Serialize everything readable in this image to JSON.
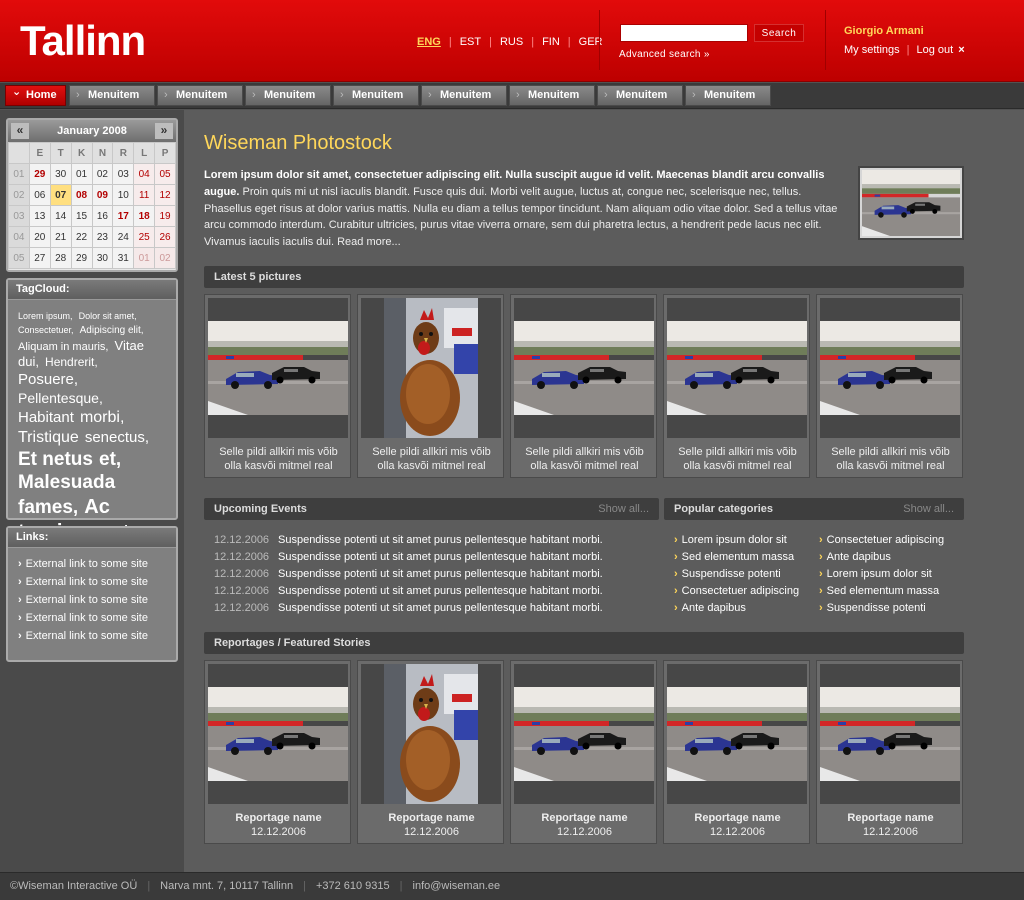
{
  "header": {
    "logo": "Tallinn",
    "languages": [
      {
        "label": "ENG",
        "active": true
      },
      {
        "label": "EST",
        "active": false
      },
      {
        "label": "RUS",
        "active": false
      },
      {
        "label": "FIN",
        "active": false
      },
      {
        "label": "GER",
        "active": false
      }
    ],
    "search": {
      "placeholder": "",
      "button": "Search",
      "advanced": "Advanced search »"
    },
    "user": {
      "name": "Giorgio Armani",
      "settings": "My settings",
      "logout": "Log out",
      "logout_icon": "×"
    }
  },
  "nav": {
    "items": [
      "Home",
      "Menuitem",
      "Menuitem",
      "Menuitem",
      "Menuitem",
      "Menuitem",
      "Menuitem",
      "Menuitem",
      "Menuitem"
    ]
  },
  "calendar": {
    "title": "January 2008",
    "prev": "«",
    "next": "»",
    "day_headers": [
      "",
      "E",
      "T",
      "K",
      "N",
      "R",
      "L",
      "P"
    ],
    "weeks": [
      [
        "01",
        "29",
        "30",
        "01",
        "02",
        "03",
        "04",
        "05"
      ],
      [
        "02",
        "06",
        "07",
        "08",
        "09",
        "10",
        "11",
        "12"
      ],
      [
        "03",
        "13",
        "14",
        "15",
        "16",
        "17",
        "18",
        "19"
      ],
      [
        "04",
        "20",
        "21",
        "22",
        "23",
        "24",
        "25",
        "26"
      ],
      [
        "05",
        "27",
        "28",
        "29",
        "30",
        "31",
        "01",
        "02"
      ]
    ]
  },
  "tagcloud": {
    "title": "TagCloud:",
    "tags": [
      {
        "text": "Lorem ipsum,",
        "size": 9
      },
      {
        "text": "Dolor sit amet,",
        "size": 9
      },
      {
        "text": "Consectetuer,",
        "size": 9
      },
      {
        "text": "Adipiscing elit,",
        "size": 10
      },
      {
        "text": "Aliquam in mauris,",
        "size": 11
      },
      {
        "text": "Vitae dui,",
        "size": 13
      },
      {
        "text": "Hendrerit,",
        "size": 12
      },
      {
        "text": "Posuere,",
        "size": 15
      },
      {
        "text": "Pellentesque,",
        "size": 14
      },
      {
        "text": "Habitant",
        "size": 15
      },
      {
        "text": "morbi,",
        "size": 16
      },
      {
        "text": "Tristique",
        "size": 16
      },
      {
        "text": "senectus,",
        "size": 15
      },
      {
        "text": "Et netus",
        "size": 19
      },
      {
        "text": "et,",
        "size": 19
      },
      {
        "text": "Malesuada",
        "size": 19
      },
      {
        "text": "fames,",
        "size": 19
      },
      {
        "text": "Ac turpis",
        "size": 20
      },
      {
        "text": "egestas.",
        "size": 19
      }
    ]
  },
  "links": {
    "title": "Links:",
    "items": [
      "External link to some site",
      "External link to some site",
      "External link to some site",
      "External link to some site",
      "External link to some site"
    ]
  },
  "main": {
    "title": "Wiseman Photostock",
    "intro_bold": "Lorem ipsum dolor sit amet, consectetuer adipiscing elit. Nulla suscipit augue id velit. Maecenas blandit arcu convallis augue.",
    "intro_text": " Proin quis mi ut nisl iaculis blandit. Fusce quis dui. Morbi velit augue, luctus at, congue nec, scelerisque nec, tellus. Phasellus eget risus at dolor varius mattis. Nulla eu diam a tellus tempor tincidunt. Nam aliquam odio vitae dolor. Sed a tellus vitae arcu commodo interdum. Curabitur ultricies, purus vitae viverra ornare, sem dui pharetra lectus, a hendrerit pede lacus nec elit. Vivamus iaculis iaculis dui.",
    "read_more": " Read more..."
  },
  "latest": {
    "title": "Latest 5 pictures",
    "items": [
      {
        "type": "car",
        "caption1": "Selle pildi allkiri mis võib",
        "caption2": "olla kasvõi mitmel real"
      },
      {
        "type": "chicken",
        "caption1": "Selle pildi allkiri mis võib",
        "caption2": "olla kasvõi mitmel real"
      },
      {
        "type": "car",
        "caption1": "Selle pildi allkiri mis võib",
        "caption2": "olla kasvõi mitmel real"
      },
      {
        "type": "car",
        "caption1": "Selle pildi allkiri mis võib",
        "caption2": "olla kasvõi mitmel real"
      },
      {
        "type": "car",
        "caption1": "Selle pildi allkiri mis võib",
        "caption2": "olla kasvõi mitmel real"
      }
    ]
  },
  "events": {
    "title": "Upcoming Events",
    "show_all": "Show all...",
    "items": [
      {
        "date": "12.12.2006",
        "text": "Suspendisse potenti ut sit amet purus pellentesque habitant morbi."
      },
      {
        "date": "12.12.2006",
        "text": "Suspendisse potenti ut sit amet purus pellentesque habitant morbi."
      },
      {
        "date": "12.12.2006",
        "text": "Suspendisse potenti ut sit amet purus pellentesque habitant morbi."
      },
      {
        "date": "12.12.2006",
        "text": "Suspendisse potenti ut sit amet purus pellentesque habitant morbi."
      },
      {
        "date": "12.12.2006",
        "text": "Suspendisse potenti ut sit amet purus pellentesque habitant morbi."
      }
    ]
  },
  "categories": {
    "title": "Popular categories",
    "show_all": "Show all...",
    "col1": [
      "Lorem ipsum dolor sit",
      "Sed elementum massa",
      "Suspendisse potenti",
      "Consectetuer adipiscing",
      "Ante dapibus"
    ],
    "col2": [
      "Consectetuer adipiscing",
      "Ante dapibus",
      "Lorem ipsum dolor sit",
      "Sed elementum massa",
      "Suspendisse potenti"
    ]
  },
  "reportages": {
    "title": "Reportages / Featured Stories",
    "items": [
      {
        "type": "car",
        "name": "Reportage name",
        "date": "12.12.2006"
      },
      {
        "type": "chicken",
        "name": "Reportage name",
        "date": "12.12.2006"
      },
      {
        "type": "car",
        "name": "Reportage name",
        "date": "12.12.2006"
      },
      {
        "type": "car",
        "name": "Reportage name",
        "date": "12.12.2006"
      },
      {
        "type": "car",
        "name": "Reportage name",
        "date": "12.12.2006"
      }
    ]
  },
  "footer": {
    "items": [
      "©Wiseman Interactive OÜ",
      "Narva mnt. 7, 10117 Tallinn",
      "+372 610 9315",
      "info@wiseman.ee"
    ]
  },
  "colors": {
    "brand_red": "#d00000",
    "accent_yellow": "#ffd75a",
    "background": "#525252"
  }
}
